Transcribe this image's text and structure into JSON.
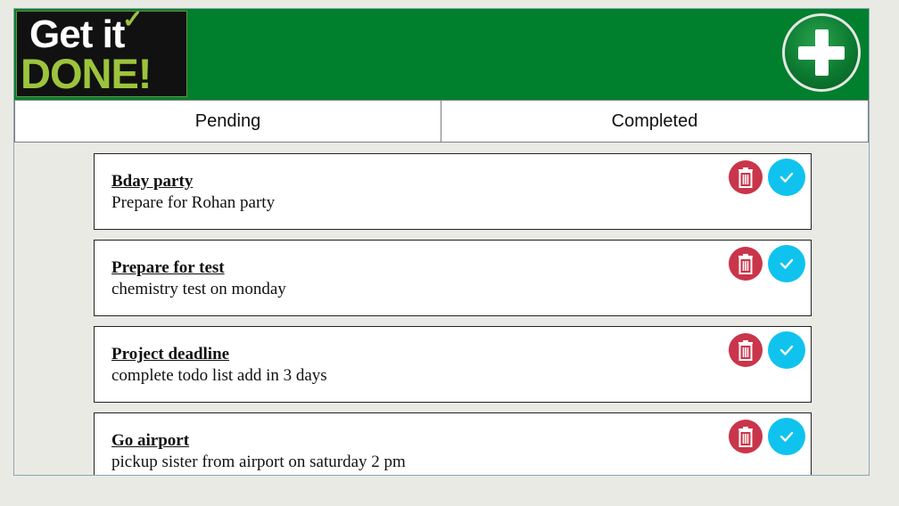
{
  "header": {
    "logo_line1": "Get it",
    "logo_line2": "DONE!",
    "add_button_icon": "plus-icon"
  },
  "tabs": [
    {
      "label": "Pending"
    },
    {
      "label": "Completed"
    }
  ],
  "tasks": [
    {
      "title": "Bday party",
      "description": "Prepare for Rohan party"
    },
    {
      "title": "Prepare for test",
      "description": "chemistry test on monday"
    },
    {
      "title": "Project deadline",
      "description": "complete todo list add in 3 days"
    },
    {
      "title": "Go airport",
      "description": "pickup sister from airport on saturday 2 pm"
    }
  ],
  "colors": {
    "header_green": "#007f2d",
    "delete_red": "#c9354a",
    "complete_blue": "#0fc3ee",
    "logo_green": "#9cc43c"
  },
  "icons": {
    "delete": "trash-icon",
    "complete": "check-icon"
  }
}
